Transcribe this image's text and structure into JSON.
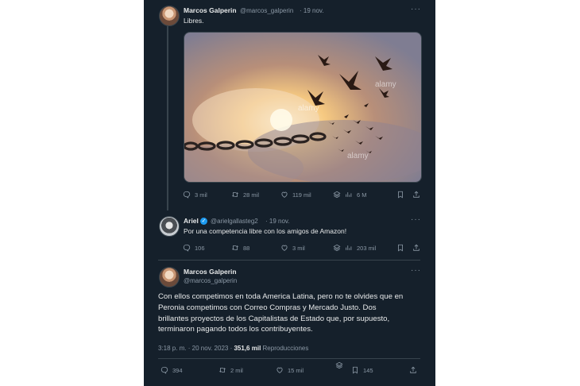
{
  "tweet1": {
    "name": "Marcos Galperin",
    "handle": "@marcos_galperin",
    "date": "· 19 nov.",
    "text": "Libres.",
    "watermarks": [
      "alamy",
      "alamy",
      "alamy"
    ],
    "stats": {
      "replies": "3 mil",
      "retweets": "28 mil",
      "likes": "119 mil",
      "views": "6 M"
    }
  },
  "tweet2": {
    "name": "Ariel",
    "handle": "@arielgallasteg2",
    "date": "· 19 nov.",
    "text": "Por una competencia libre con los amigos de Amazon!",
    "stats": {
      "replies": "106",
      "retweets": "88",
      "likes": "3 mil",
      "views": "203 mil"
    }
  },
  "tweet3": {
    "name": "Marcos Galperin",
    "handle": "@marcos_galperin",
    "lines": [
      "Con ellos competimos en toda America Latina, pero no te olvides que en",
      "Peronia competimos con Correo Compras y Mercado Justo. Dos",
      "brillantes proyectos de los Capitalistas de Estado que, por supuesto,",
      "terminaron pagando todos los contribuyentes."
    ],
    "timestamp": "3:18 p. m. · 20 nov. 2023 ·",
    "views_count": "351,6 mil",
    "views_label": "Reproducciones",
    "stats": {
      "replies": "394",
      "retweets": "2 mil",
      "likes": "15 mil",
      "bookmarks": "145"
    }
  },
  "more_glyph": "···",
  "verified_glyph": "✓",
  "icons": [
    "reply-icon",
    "retweet-icon",
    "like-icon",
    "views-icon",
    "bookmark-icon",
    "share-icon"
  ],
  "colors": {
    "background": "#15202b",
    "text": "#e7e9ea",
    "secondary": "#8b98a5",
    "verified": "#1d9bf0"
  }
}
